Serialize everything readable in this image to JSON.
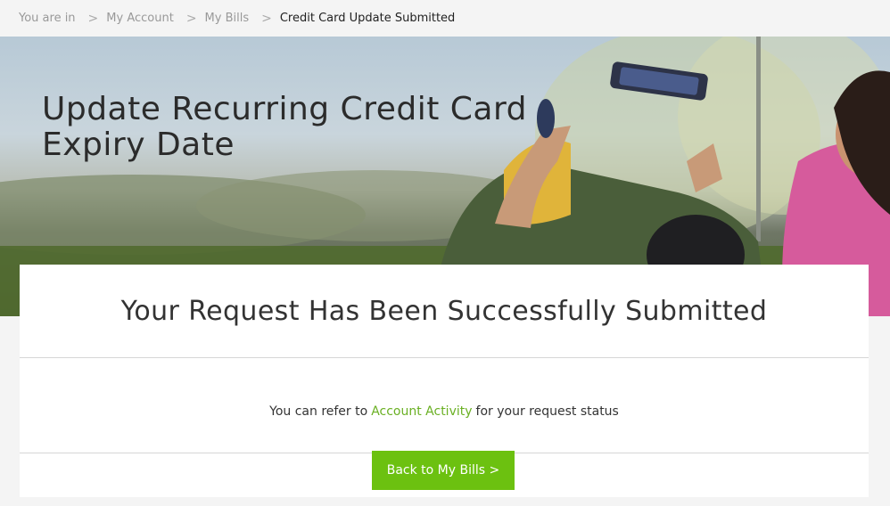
{
  "breadcrumb": {
    "prefix": "You are in",
    "items": [
      "My Account",
      "My Bills"
    ],
    "current": "Credit Card Update Submitted",
    "separator": ">"
  },
  "hero": {
    "title_line1": "Update Recurring Credit Card",
    "title_line2": "Expiry Date"
  },
  "confirmation": {
    "title": "Your Request Has Been Successfully Submitted",
    "message_before": "You can refer to",
    "link_text": "Account Activity",
    "message_after": "for your request status",
    "button_label": "Back to My Bills >"
  },
  "colors": {
    "accent": "#6cc110",
    "link": "#6ab023"
  }
}
